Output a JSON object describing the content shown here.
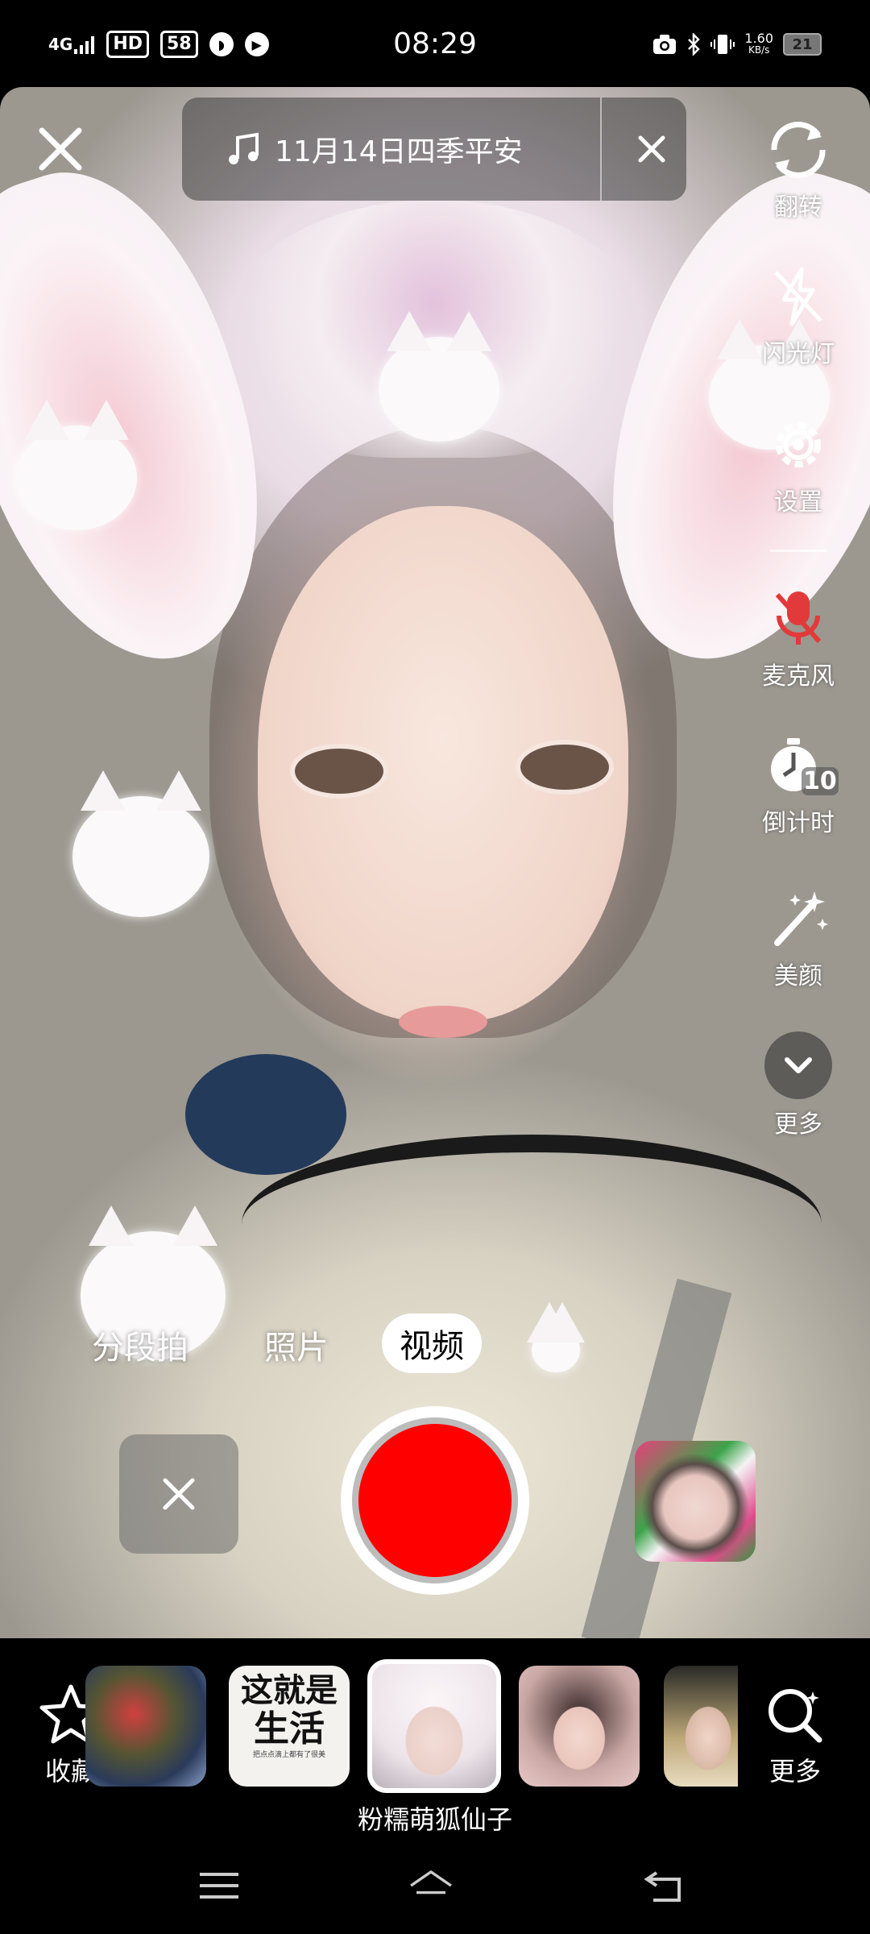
{
  "status_bar": {
    "network": "4G",
    "hd_label": "HD",
    "notif_count": "58",
    "time": "08:29",
    "net_speed_value": "1.60",
    "net_speed_unit": "KB/s",
    "battery": "21"
  },
  "music": {
    "title": "11月14日四季平安"
  },
  "right_rail": {
    "flip": "翻转",
    "flash": "闪光灯",
    "settings": "设置",
    "mic": "麦克风",
    "timer": "倒计时",
    "timer_value": "10",
    "beauty": "美颜",
    "more": "更多"
  },
  "modes": {
    "segment": "分段拍",
    "photo": "照片",
    "video": "视频",
    "selected": "视频"
  },
  "effects": {
    "favorites": "收藏",
    "thumb2_text_line1": "这就是",
    "thumb2_text_line2": "生活",
    "thumb2_caption": "把点点滴上都有了很美",
    "selected_name": "粉糯萌狐仙子",
    "more": "更多"
  },
  "colors": {
    "record": "#ff0000",
    "mic_muted": "#e23a3a"
  }
}
